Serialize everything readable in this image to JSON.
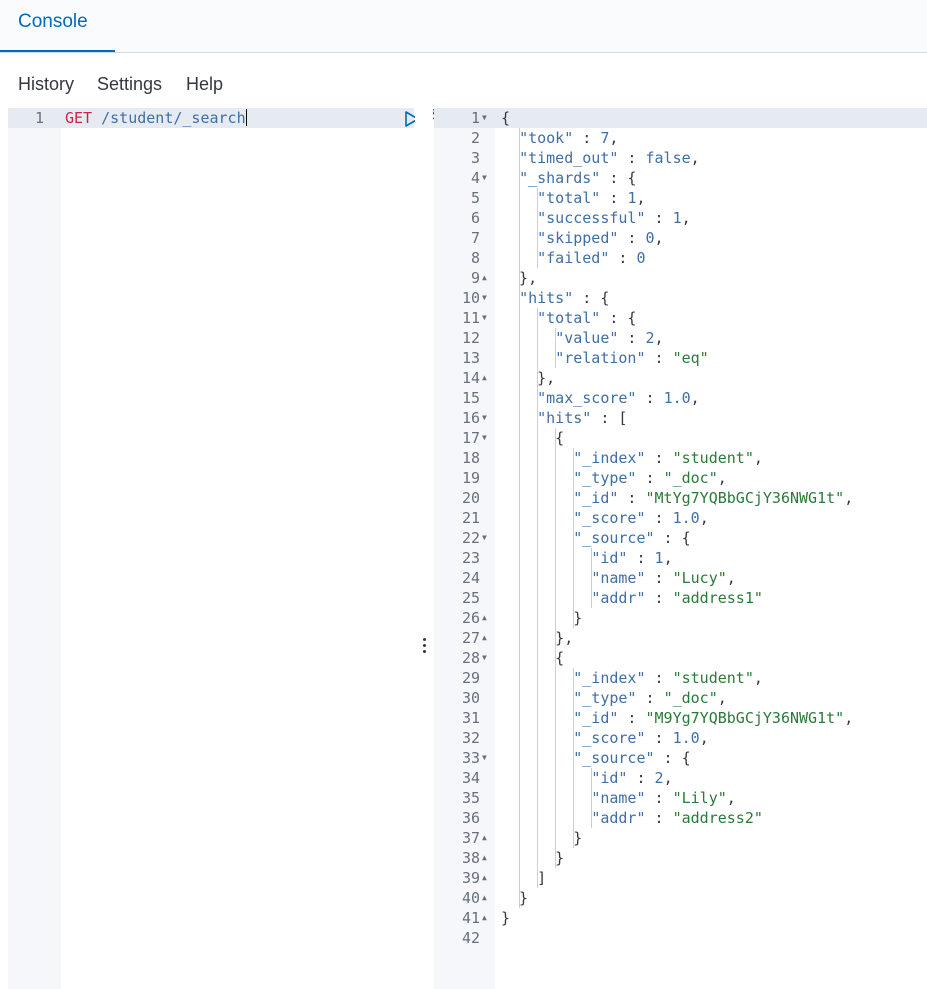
{
  "header": {
    "tab_console": "Console"
  },
  "menu": {
    "history": "History",
    "settings": "Settings",
    "help": "Help"
  },
  "request_editor": {
    "line_numbers": [
      "1"
    ],
    "method": "GET",
    "path": "/student/_search",
    "icons": [
      "play-icon",
      "wrench-icon"
    ]
  },
  "response_editor": {
    "lines": [
      "{",
      "  \"took\" : 7,",
      "  \"timed_out\" : false,",
      "  \"_shards\" : {",
      "    \"total\" : 1,",
      "    \"successful\" : 1,",
      "    \"skipped\" : 0,",
      "    \"failed\" : 0",
      "  },",
      "  \"hits\" : {",
      "    \"total\" : {",
      "      \"value\" : 2,",
      "      \"relation\" : \"eq\"",
      "    },",
      "    \"max_score\" : 1.0,",
      "    \"hits\" : [",
      "      {",
      "        \"_index\" : \"student\",",
      "        \"_type\" : \"_doc\",",
      "        \"_id\" : \"MtYg7YQBbGCjY36NWG1t\",",
      "        \"_score\" : 1.0,",
      "        \"_source\" : {",
      "          \"id\" : 1,",
      "          \"name\" : \"Lucy\",",
      "          \"addr\" : \"address1\"",
      "        }",
      "      },",
      "      {",
      "        \"_index\" : \"student\",",
      "        \"_type\" : \"_doc\",",
      "        \"_id\" : \"M9Yg7YQBbGCjY36NWG1t\",",
      "        \"_score\" : 1.0,",
      "        \"_source\" : {",
      "          \"id\" : 2,",
      "          \"name\" : \"Lily\",",
      "          \"addr\" : \"address2\"",
      "        }",
      "      }",
      "    ]",
      "  }",
      "}",
      ""
    ],
    "fold_markers": {
      "1": "down",
      "4": "down",
      "9": "up",
      "10": "down",
      "11": "down",
      "14": "up",
      "16": "down",
      "17": "down",
      "22": "down",
      "26": "up",
      "27": "up",
      "28": "down",
      "33": "down",
      "37": "up",
      "38": "up",
      "39": "up",
      "40": "up",
      "41": "up"
    }
  },
  "colors": {
    "accent": "#006bb8",
    "method": "#c7254e",
    "key": "#3f6fa5",
    "string": "#2a7a3a",
    "gutter": "#f5f7fa",
    "active_line": "#e6ebf2"
  }
}
